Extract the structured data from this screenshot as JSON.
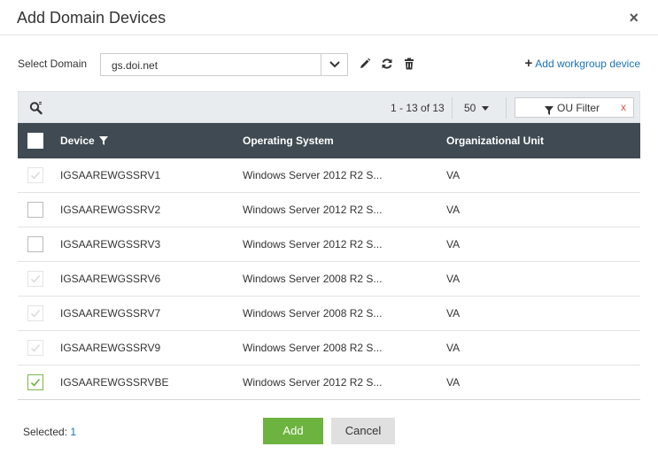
{
  "dialog": {
    "title": "Add Domain Devices",
    "close_label": "×"
  },
  "domain": {
    "label": "Select Domain",
    "value": "gs.doi.net",
    "edit_icon": "pencil-icon",
    "refresh_icon": "refresh-icon",
    "delete_icon": "trash-icon",
    "add_workgroup_label": "Add workgroup device"
  },
  "toolbar": {
    "page_info": "1 - 13 of 13",
    "per_page": "50",
    "ou_filter_label": "OU Filter",
    "ou_filter_clear": "x"
  },
  "table": {
    "columns": [
      "Device",
      "Operating System",
      "Organizational Unit"
    ],
    "rows": [
      {
        "device": "IGSAAREWGSSRV1",
        "os": "Windows Server 2012 R2 S...",
        "ou": "VA",
        "state": "disabled"
      },
      {
        "device": "IGSAAREWGSSRV2",
        "os": "Windows Server 2012 R2 S...",
        "ou": "VA",
        "state": "unchecked"
      },
      {
        "device": "IGSAAREWGSSRV3",
        "os": "Windows Server 2012 R2 S...",
        "ou": "VA",
        "state": "unchecked"
      },
      {
        "device": "IGSAAREWGSSRV6",
        "os": "Windows Server 2008 R2 S...",
        "ou": "VA",
        "state": "disabled"
      },
      {
        "device": "IGSAAREWGSSRV7",
        "os": "Windows Server 2008 R2 S...",
        "ou": "VA",
        "state": "disabled"
      },
      {
        "device": "IGSAAREWGSSRV9",
        "os": "Windows Server 2008 R2 S...",
        "ou": "VA",
        "state": "disabled"
      },
      {
        "device": "IGSAAREWGSSRVBE",
        "os": "Windows Server 2012 R2 S...",
        "ou": "VA",
        "state": "checked"
      }
    ]
  },
  "footer": {
    "selected_label": "Selected:",
    "selected_count": "1",
    "add_label": "Add",
    "cancel_label": "Cancel"
  },
  "colors": {
    "accent_green": "#6db33f",
    "header_dark": "#3f4a52",
    "link_blue": "#1a72b8"
  }
}
